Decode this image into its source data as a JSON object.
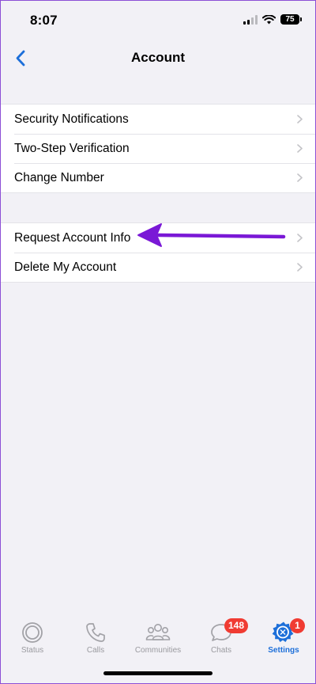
{
  "status_bar": {
    "time": "8:07",
    "battery": "75"
  },
  "nav": {
    "title": "Account",
    "back_icon": "chevron-left-icon"
  },
  "groups": [
    {
      "items": [
        {
          "label": "Security Notifications"
        },
        {
          "label": "Two-Step Verification"
        },
        {
          "label": "Change Number"
        }
      ]
    },
    {
      "items": [
        {
          "label": "Request Account Info"
        },
        {
          "label": "Delete My Account"
        }
      ]
    }
  ],
  "annotation": {
    "color": "#7a18d6",
    "target": "Request Account Info"
  },
  "tabs": [
    {
      "label": "Status",
      "icon": "status-icon",
      "badge": ""
    },
    {
      "label": "Calls",
      "icon": "phone-icon",
      "badge": ""
    },
    {
      "label": "Communities",
      "icon": "communities-icon",
      "badge": ""
    },
    {
      "label": "Chats",
      "icon": "chat-bubble-icon",
      "badge": "148"
    },
    {
      "label": "Settings",
      "icon": "settings-gear-icon",
      "badge": "1",
      "active": true
    }
  ],
  "colors": {
    "accent": "#1d6fd9",
    "badge": "#f03b32",
    "background": "#f2f1f6"
  }
}
